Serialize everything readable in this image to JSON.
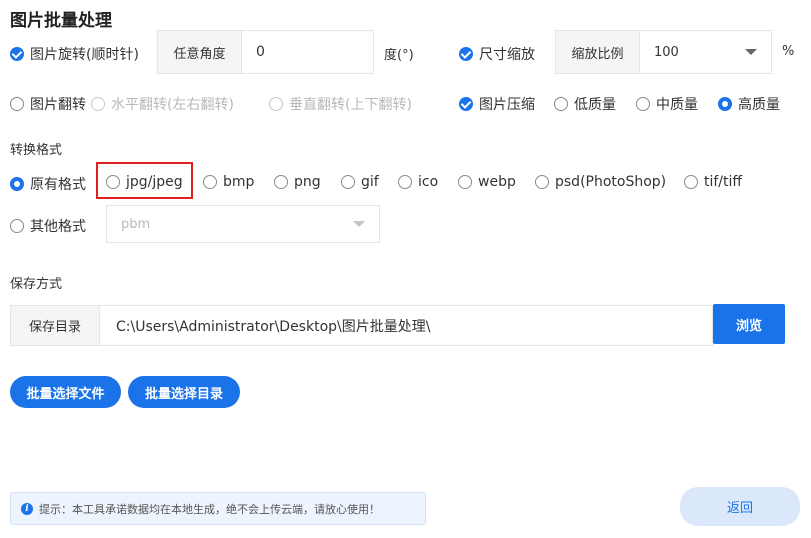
{
  "title": "图片批量处理",
  "rotate": {
    "label": "图片旋转(顺时针)",
    "angle_label": "任意角度",
    "angle_value": "0",
    "unit": "度(°)"
  },
  "resize": {
    "label": "尺寸缩放",
    "scale_label": "缩放比例",
    "scale_value": "100",
    "unit": "%"
  },
  "flip": {
    "label": "图片翻转",
    "horizontal": "水平翻转(左右翻转)",
    "vertical": "垂直翻转(上下翻转)"
  },
  "compress": {
    "label": "图片压缩",
    "low": "低质量",
    "medium": "中质量",
    "high": "高质量"
  },
  "format": {
    "section": "转换格式",
    "original": "原有格式",
    "options": [
      "jpg/jpeg",
      "bmp",
      "png",
      "gif",
      "ico",
      "webp",
      "psd(PhotoShop)",
      "tif/tiff"
    ],
    "other": "其他格式",
    "other_value": "pbm"
  },
  "save": {
    "section": "保存方式",
    "dir_label": "保存目录",
    "dir_value": "C:\\Users\\Administrator\\Desktop\\图片批量处理\\",
    "browse": "浏览"
  },
  "actions": {
    "select_files": "批量选择文件",
    "select_dir": "批量选择目录",
    "back": "返回"
  },
  "tip": "提示：本工具承诺数据均在本地生成，绝不会上传云端，请放心使用！",
  "colors": {
    "accent": "#1a73e8",
    "highlight": "#e0201e"
  }
}
